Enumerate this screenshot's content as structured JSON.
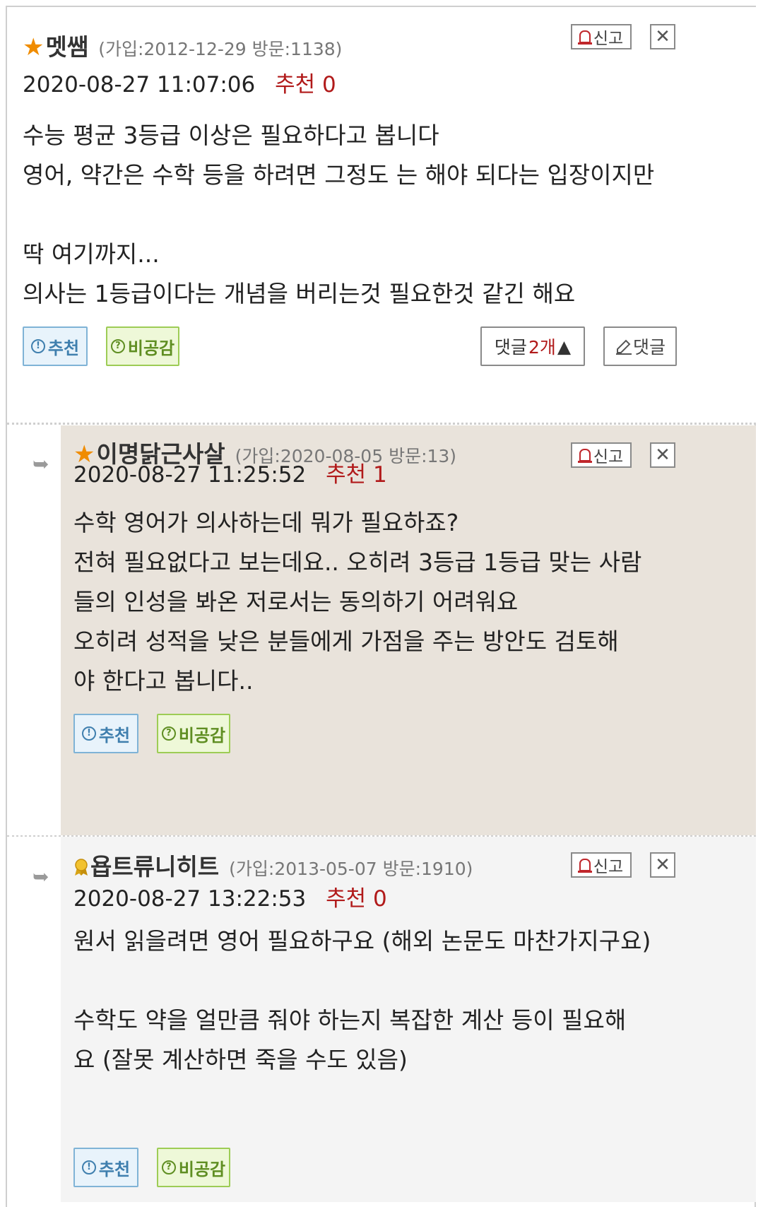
{
  "comments": [
    {
      "nickname": "멧쌤",
      "meta": "(가입:2012-12-29 방문:1138)",
      "datetime": "2020-08-27 11:07:06",
      "recommend": "추천 0",
      "lines": [
        "수능 평균 3등급 이상은 필요하다고 봅니다",
        "영어, 약간은 수학 등을 하려면 그정도 는 해야 되다는 입장이지만",
        "",
        "딱 여기까지...",
        "의사는 1등급이다는 개념을 버리는것  필요한것 같긴 해요"
      ],
      "report_label": "신고",
      "close_label": "✕",
      "recommend_btn": "추천",
      "dislike_btn": "비공감",
      "replies_label": "댓글",
      "replies_count": "2개",
      "replies_arrow": "▲",
      "write_reply_label": "댓글"
    },
    {
      "nickname": "이명닭근사살",
      "meta": "(가입:2020-08-05 방문:13)",
      "datetime": "2020-08-27 11:25:52",
      "recommend": "추천 1",
      "lines": [
        "수학 영어가 의사하는데 뭐가 필요하죠?",
        "전혀 필요없다고 보는데요.. 오히려 3등급 1등급 맞는 사람",
        "들의 인성을 봐온 저로서는 동의하기 어려워요",
        "오히려 성적을 낮은 분들에게 가점을 주는 방안도 검토해",
        "야 한다고 봅니다.."
      ],
      "report_label": "신고",
      "close_label": "✕",
      "recommend_btn": "추천",
      "dislike_btn": "비공감"
    },
    {
      "nickname": "욥트류니히트",
      "meta": "(가입:2013-05-07 방문:1910)",
      "datetime": "2020-08-27 13:22:53",
      "recommend": "추천 0",
      "lines": [
        "원서 읽을려면 영어 필요하구요 (해외 논문도 마찬가지구요)",
        "",
        "수학도 약을 얼만큼 줘야 하는지 복잡한 계산 등이 필요해",
        "요 (잘못 계산하면 죽을 수도 있음)"
      ],
      "report_label": "신고",
      "close_label": "✕",
      "recommend_btn": "추천",
      "dislike_btn": "비공감"
    }
  ],
  "icons": {
    "star": "★",
    "reply_arrow": "➥",
    "info": "!",
    "question": "?",
    "write_reply_icon": "pen-icon"
  },
  "colors": {
    "recommend_red": "#b11a1a",
    "star_orange": "#f08c00",
    "reply_bg_1": "#e9e3db",
    "reply_bg_2": "#f4f4f4"
  }
}
